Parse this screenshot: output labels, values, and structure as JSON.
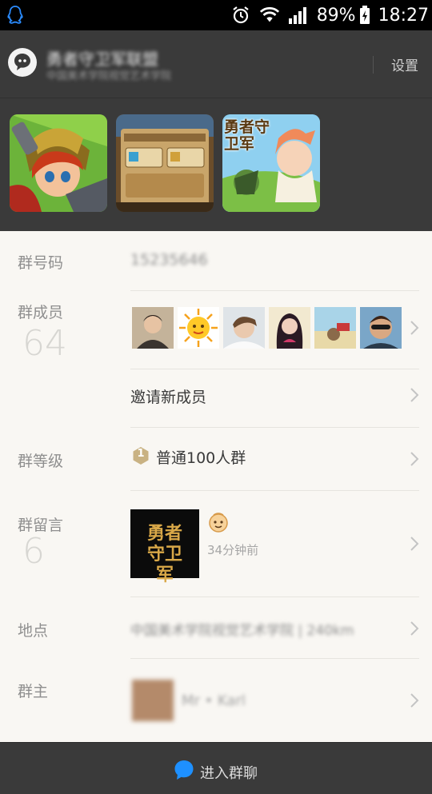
{
  "status_bar": {
    "battery": "89%",
    "time": "18:27"
  },
  "header": {
    "title": "勇者守卫军联盟",
    "subtitle": "中国美术学院视觉艺术学院",
    "settings_label": "设置"
  },
  "banner": {
    "logo_text": "勇者守卫军"
  },
  "group_number": {
    "label": "群号码",
    "value": "15235646"
  },
  "members": {
    "label": "群成员",
    "count": "64"
  },
  "invite": {
    "label": "邀请新成员"
  },
  "level": {
    "label": "群等级",
    "badge": "1",
    "value": "普通100人群"
  },
  "messages": {
    "label": "群留言",
    "count": "6",
    "time": "34分钟前",
    "thumb_text": "勇者守卫军"
  },
  "location": {
    "label": "地点",
    "value": "中国美术学院视觉艺术学院 | 240km"
  },
  "owner": {
    "label": "群主",
    "name": "Mr • Karl"
  },
  "bottom": {
    "enter_chat_label": "进入群聊"
  },
  "colors": {
    "accent": "#1e90ff",
    "header_bg": "#3a3a3a",
    "page_bg": "#f9f7f3"
  }
}
